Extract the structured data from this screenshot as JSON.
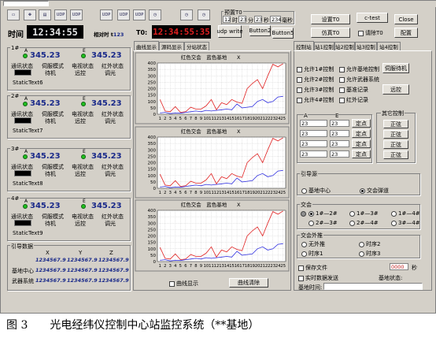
{
  "toolbar": {
    "icons": [
      "UDP",
      "UDP",
      "UDP",
      "UDP",
      "UDP"
    ],
    "time_label": "时间",
    "main_time": "12:34:55",
    "relative_label": "相对时 t",
    "relative_value": "123",
    "t0_label": "T0:",
    "t0_time": "12:34:55:35",
    "udp_write": "udp write",
    "button2": "Button2",
    "button5": "Button5",
    "pretime_label": "预置T0",
    "pretime_fields": [
      "12",
      "23",
      "23",
      "234"
    ],
    "pretime_units": [
      "时",
      "分",
      "秒",
      "毫秒"
    ],
    "set_t0": "设置T0",
    "simulate_t0": "仿真T0",
    "c_test": "c-test",
    "close": "Close",
    "clear_t0": "请除T0",
    "config": "配置"
  },
  "units": [
    {
      "name": "1#",
      "a": "345.23",
      "e": "345.23",
      "labels": [
        "通讯状态",
        "伺服模式",
        "电视状态",
        "红外状态"
      ],
      "values": [
        "",
        "待机",
        "远控",
        "调光"
      ],
      "static": "StaticText6"
    },
    {
      "name": "2#",
      "a": "345.23",
      "e": "345.23",
      "labels": [
        "通讯状态",
        "伺服模式",
        "电视状态",
        "红外状态"
      ],
      "values": [
        "",
        "待机",
        "远控",
        "调光"
      ],
      "static": "StaticText7"
    },
    {
      "name": "3#",
      "a": "345.23",
      "e": "345.23",
      "labels": [
        "通讯状态",
        "伺服模式",
        "电视状态",
        "红外状态"
      ],
      "values": [
        "",
        "待机",
        "远控",
        "调光"
      ],
      "static": "StaticText8"
    },
    {
      "name": "4#",
      "a": "345.23",
      "e": "345.23",
      "labels": [
        "通讯状态",
        "伺服模式",
        "电视状态",
        "红外状态"
      ],
      "values": [
        "",
        "待机",
        "远控",
        "调光"
      ],
      "static": "StaticText9"
    }
  ],
  "guide": {
    "title": "引导数据",
    "cols": [
      "X",
      "Y",
      "Z"
    ],
    "rows": [
      {
        "label": "",
        "vals": [
          "1234567.9",
          "1234567.9",
          "1234567.9"
        ]
      },
      {
        "label": "基地中心",
        "vals": [
          "1234567.9",
          "1234567.9",
          "1234567.9"
        ]
      },
      {
        "label": "武器系统",
        "vals": [
          "1234567.9",
          "1234567.9",
          "1234567.9"
        ]
      }
    ]
  },
  "center_tabs": [
    "曲线显示",
    "源码显示",
    "分站状态"
  ],
  "chart_title": "红色交会　蓝色基地",
  "chart_close": "X",
  "chart_footer": {
    "checkbox": "曲线显示",
    "clear": "曲线清除"
  },
  "chart_data": [
    {
      "type": "line",
      "title": "红色交会　蓝色基地",
      "x": [
        1,
        2,
        3,
        4,
        5,
        6,
        7,
        8,
        9,
        10,
        11,
        12,
        13,
        14,
        15,
        16,
        17,
        18,
        19,
        20,
        21,
        22,
        23,
        24,
        25
      ],
      "ylim": [
        0,
        400
      ],
      "yticks": [
        0,
        50,
        100,
        150,
        200,
        250,
        300,
        350,
        400
      ],
      "series": [
        {
          "name": "红色交会",
          "color": "#e02020",
          "values": [
            115,
            25,
            20,
            60,
            15,
            20,
            55,
            40,
            40,
            65,
            115,
            35,
            90,
            75,
            115,
            95,
            85,
            200,
            240,
            270,
            200,
            300,
            390,
            370,
            395
          ]
        },
        {
          "name": "蓝色基地",
          "color": "#3030e0",
          "values": [
            10,
            15,
            5,
            10,
            8,
            15,
            20,
            25,
            20,
            30,
            25,
            30,
            35,
            40,
            35,
            80,
            50,
            55,
            60,
            100,
            115,
            90,
            100,
            135,
            140
          ]
        }
      ]
    },
    {
      "type": "line",
      "title": "红色交会　蓝色基地",
      "x": [
        1,
        2,
        3,
        4,
        5,
        6,
        7,
        8,
        9,
        10,
        11,
        12,
        13,
        14,
        15,
        16,
        17,
        18,
        19,
        20,
        21,
        22,
        23,
        24,
        25
      ],
      "ylim": [
        0,
        400
      ],
      "yticks": [
        0,
        50,
        100,
        150,
        200,
        250,
        300,
        350,
        400
      ],
      "series": [
        {
          "name": "红色交会",
          "color": "#e02020",
          "values": [
            110,
            25,
            20,
            60,
            15,
            20,
            55,
            40,
            40,
            65,
            115,
            35,
            90,
            75,
            115,
            95,
            85,
            200,
            240,
            270,
            200,
            300,
            390,
            370,
            395
          ]
        },
        {
          "name": "蓝色基地",
          "color": "#3030e0",
          "values": [
            10,
            15,
            5,
            10,
            8,
            15,
            20,
            25,
            20,
            30,
            25,
            30,
            35,
            40,
            35,
            80,
            50,
            55,
            60,
            100,
            115,
            90,
            100,
            135,
            140
          ]
        }
      ]
    },
    {
      "type": "line",
      "title": "红色交会　蓝色基地",
      "x": [
        1,
        2,
        3,
        4,
        5,
        6,
        7,
        8,
        9,
        10,
        11,
        12,
        13,
        14,
        15,
        16,
        17,
        18,
        19,
        20,
        21,
        22,
        23,
        24,
        25
      ],
      "ylim": [
        0,
        400
      ],
      "yticks": [
        0,
        50,
        100,
        150,
        200,
        250,
        300,
        350,
        400
      ],
      "series": [
        {
          "name": "红色交会",
          "color": "#e02020",
          "values": [
            110,
            25,
            20,
            60,
            15,
            20,
            55,
            40,
            40,
            65,
            115,
            35,
            90,
            75,
            115,
            95,
            85,
            200,
            240,
            270,
            200,
            300,
            390,
            370,
            395
          ]
        },
        {
          "name": "蓝色基地",
          "color": "#3030e0",
          "values": [
            10,
            15,
            5,
            10,
            8,
            15,
            20,
            25,
            20,
            30,
            25,
            30,
            35,
            40,
            35,
            80,
            50,
            55,
            60,
            100,
            115,
            90,
            100,
            135,
            140
          ]
        }
      ]
    }
  ],
  "right_tabs": [
    "控制站",
    "站1控制",
    "站2控制",
    "站3控制",
    "站4控制"
  ],
  "control": {
    "checks": [
      "允许1#控制",
      "允许基地控制",
      "允许2#控制",
      "允许武器系统",
      "允许3#控制",
      "基准记录",
      "允许4#控制",
      "红外记录"
    ],
    "servo_btn": "伺服待机",
    "remote_btn": "远控",
    "ae_headers": [
      "A",
      "E"
    ],
    "ae_values": [
      [
        "23",
        "23"
      ],
      [
        "23",
        "23"
      ],
      [
        "23",
        "23"
      ],
      [
        "23",
        "23"
      ]
    ],
    "point_btn": "定点",
    "other_title": "其它控制",
    "other_btns": [
      "正弦",
      "正弦",
      "正弦",
      "正弦"
    ],
    "guide_src": "引导源",
    "guide_opts": [
      "基地中心",
      "交会弹道"
    ],
    "meet": "交会",
    "meet_opts": [
      "1#—2#",
      "1#—3#",
      "1#—4#",
      "2#—3#",
      "2#—4#",
      "3#—4#"
    ],
    "ext": "交会外推",
    "ext_opts": [
      "无外推",
      "时序2",
      "时序1",
      "时序3"
    ],
    "save_file": "保存文件",
    "save_value": "0000",
    "save_unit": "秒",
    "realtime_send": "实时数据发送",
    "base_time": "基地时间:",
    "base_state": "基地状态:"
  },
  "caption": "图 3　　光电经纬仪控制中心站监控系统（**基地）"
}
